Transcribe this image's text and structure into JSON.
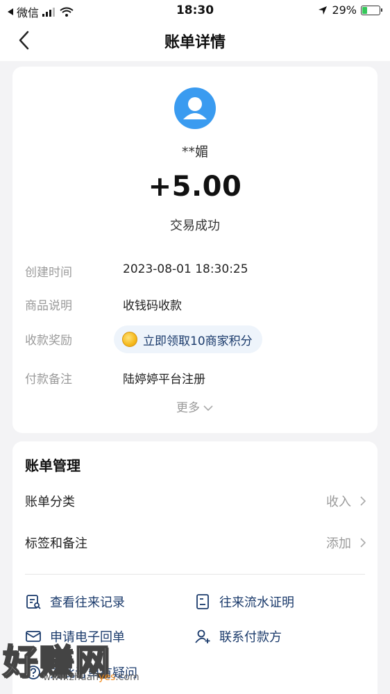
{
  "status_bar": {
    "carrier": "微信",
    "time": "18:30",
    "battery": "29%",
    "battery_level": 0.29
  },
  "nav": {
    "title": "账单详情",
    "back_icon": "chevron-left-icon"
  },
  "transaction": {
    "payer_name": "**媚",
    "amount": "+5.00",
    "status": "交易成功",
    "details": [
      {
        "label": "创建时间",
        "value": "2023-08-01 18:30:25"
      },
      {
        "label": "商品说明",
        "value": "收钱码收款"
      },
      {
        "label": "收款奖励",
        "value": "立即领取10商家积分"
      },
      {
        "label": "付款备注",
        "value": "陆婷婷平台注册"
      }
    ],
    "more_label": "更多"
  },
  "bill_management": {
    "title": "账单管理",
    "rows": [
      {
        "label": "账单分类",
        "value": "收入"
      },
      {
        "label": "标签和备注",
        "value": "添加"
      }
    ],
    "actions": [
      {
        "label": "查看往来记录",
        "icon": "records-icon"
      },
      {
        "label": "往来流水证明",
        "icon": "statement-icon"
      },
      {
        "label": "申请电子回单",
        "icon": "receipt-mail-icon"
      },
      {
        "label": "联系付款方",
        "icon": "contact-user-icon"
      },
      {
        "label": "对此订单有疑问",
        "icon": "question-icon"
      }
    ]
  },
  "watermark": {
    "text": "好赚网",
    "url_prefix": "www.zhuan",
    "url_accent": "yes",
    "url_suffix": ".com"
  },
  "colors": {
    "accent_blue": "#3a9bf0",
    "link_navy": "#1a3a6b",
    "battery_green": "#34c759",
    "background": "#f3f3f5"
  }
}
